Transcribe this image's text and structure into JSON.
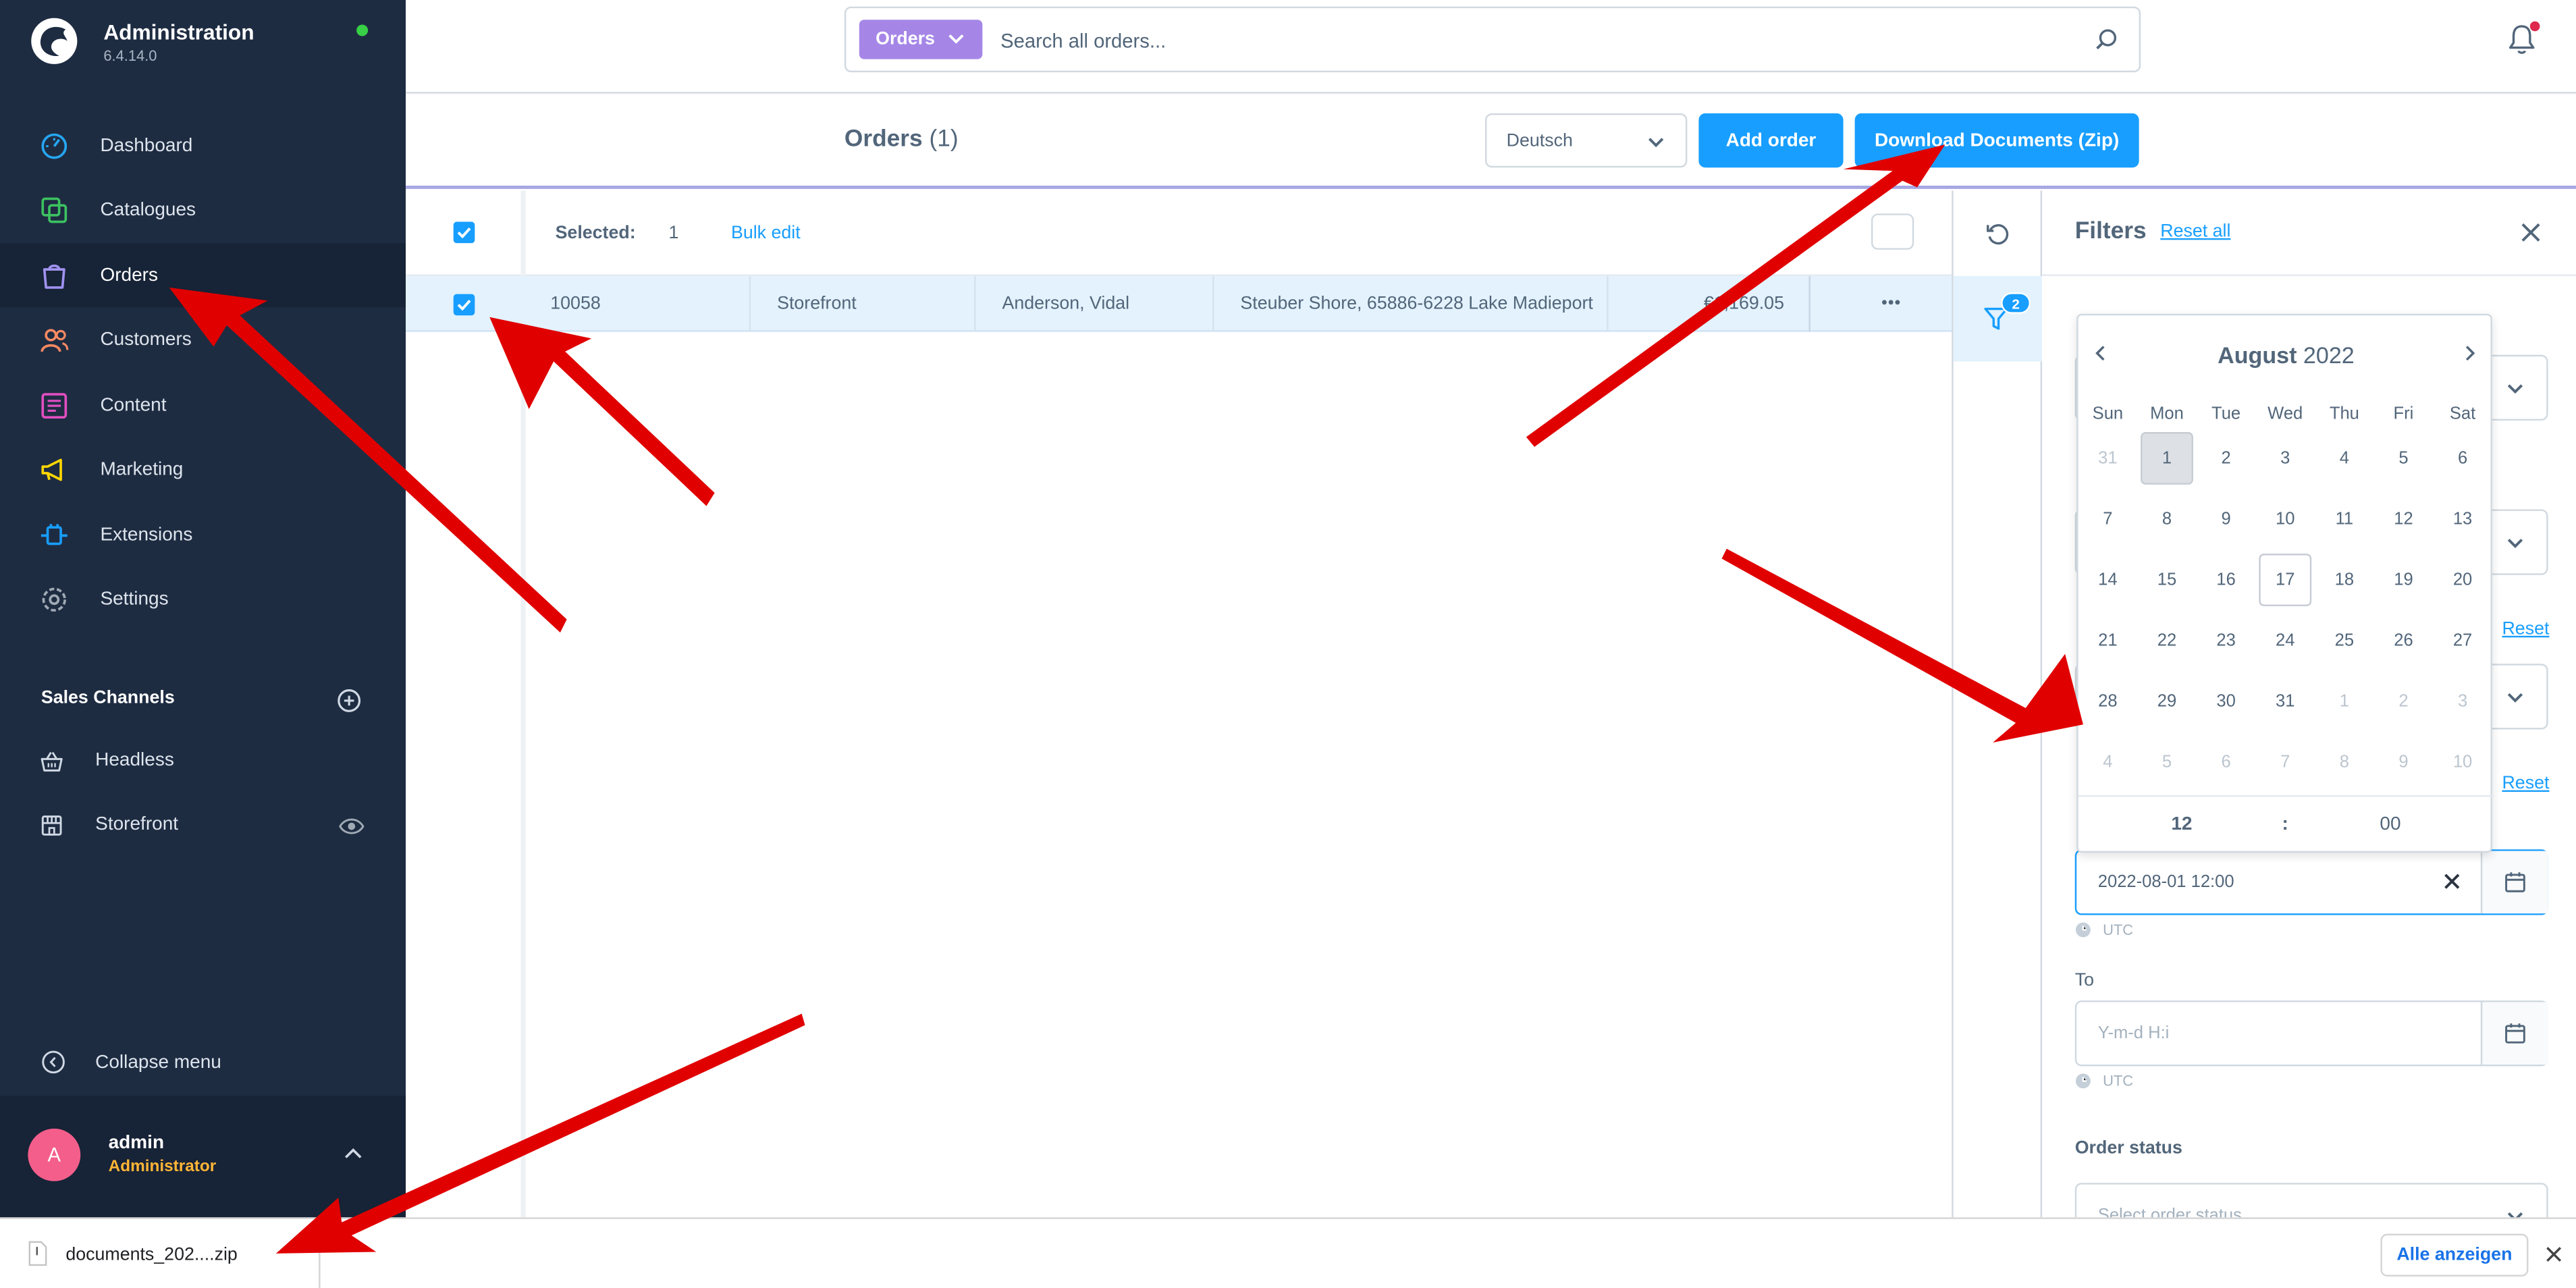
{
  "brand": {
    "title": "Administration",
    "version": "6.4.14.0"
  },
  "nav": [
    {
      "label": "Dashboard",
      "icon": "dashboard-icon"
    },
    {
      "label": "Catalogues",
      "icon": "catalogues-icon"
    },
    {
      "label": "Orders",
      "icon": "orders-icon",
      "active": true
    },
    {
      "label": "Customers",
      "icon": "customers-icon"
    },
    {
      "label": "Content",
      "icon": "content-icon"
    },
    {
      "label": "Marketing",
      "icon": "marketing-icon"
    },
    {
      "label": "Extensions",
      "icon": "extensions-icon"
    },
    {
      "label": "Settings",
      "icon": "settings-icon"
    }
  ],
  "sales_channels": {
    "heading": "Sales Channels",
    "items": [
      {
        "label": "Headless",
        "icon": "basket-icon"
      },
      {
        "label": "Storefront",
        "icon": "storefront-icon"
      }
    ]
  },
  "collapse_label": "Collapse menu",
  "user": {
    "initial": "A",
    "name": "admin",
    "role": "Administrator"
  },
  "search": {
    "tag": "Orders",
    "placeholder": "Search all orders..."
  },
  "smartbar": {
    "title": "Orders",
    "count": "(1)",
    "language": "Deutsch",
    "add_order": "Add order",
    "download_docs": "Download Documents (Zip)"
  },
  "grid": {
    "selected_label": "Selected:",
    "selected_count": "1",
    "bulk_edit": "Bulk edit",
    "row": {
      "order_number": "10058",
      "sales_channel": "Storefront",
      "customer": "Anderson, Vidal",
      "address": "Steuber Shore, 65886-6228 Lake Madieport",
      "amount": "€1,169.05"
    }
  },
  "filters": {
    "title": "Filters",
    "reset_all": "Reset all",
    "active_count": "2",
    "reset": "Reset",
    "from_value": "2022-08-01 12:00",
    "timezone": "UTC",
    "to_label": "To",
    "to_placeholder": "Y-m-d H:i",
    "order_status_label": "Order status",
    "order_status_placeholder": "Select order status..."
  },
  "calendar": {
    "month": "August",
    "year": "2022",
    "weekdays": [
      "Sun",
      "Mon",
      "Tue",
      "Wed",
      "Thu",
      "Fri",
      "Sat"
    ],
    "weeks": [
      [
        {
          "d": "31",
          "m": true
        },
        {
          "d": "1",
          "sel": true
        },
        {
          "d": "2"
        },
        {
          "d": "3"
        },
        {
          "d": "4"
        },
        {
          "d": "5"
        },
        {
          "d": "6"
        }
      ],
      [
        {
          "d": "7"
        },
        {
          "d": "8"
        },
        {
          "d": "9"
        },
        {
          "d": "10"
        },
        {
          "d": "11"
        },
        {
          "d": "12"
        },
        {
          "d": "13"
        }
      ],
      [
        {
          "d": "14"
        },
        {
          "d": "15"
        },
        {
          "d": "16"
        },
        {
          "d": "17",
          "today": true
        },
        {
          "d": "18"
        },
        {
          "d": "19"
        },
        {
          "d": "20"
        }
      ],
      [
        {
          "d": "21"
        },
        {
          "d": "22"
        },
        {
          "d": "23"
        },
        {
          "d": "24"
        },
        {
          "d": "25"
        },
        {
          "d": "26"
        },
        {
          "d": "27"
        }
      ],
      [
        {
          "d": "28"
        },
        {
          "d": "29"
        },
        {
          "d": "30"
        },
        {
          "d": "31"
        },
        {
          "d": "1",
          "m": true
        },
        {
          "d": "2",
          "m": true
        },
        {
          "d": "3",
          "m": true
        }
      ],
      [
        {
          "d": "4",
          "m": true
        },
        {
          "d": "5",
          "m": true
        },
        {
          "d": "6",
          "m": true
        },
        {
          "d": "7",
          "m": true
        },
        {
          "d": "8",
          "m": true
        },
        {
          "d": "9",
          "m": true
        },
        {
          "d": "10",
          "m": true
        }
      ]
    ],
    "hour": "12",
    "separator": ":",
    "minute": "00"
  },
  "download_bar": {
    "filename": "documents_202....zip",
    "show_all": "Alle anzeigen"
  },
  "colors": {
    "sidebar": "#1e2c42",
    "primary": "#189eff",
    "search_tag": "#a586e7",
    "arrow": "#e00000"
  }
}
